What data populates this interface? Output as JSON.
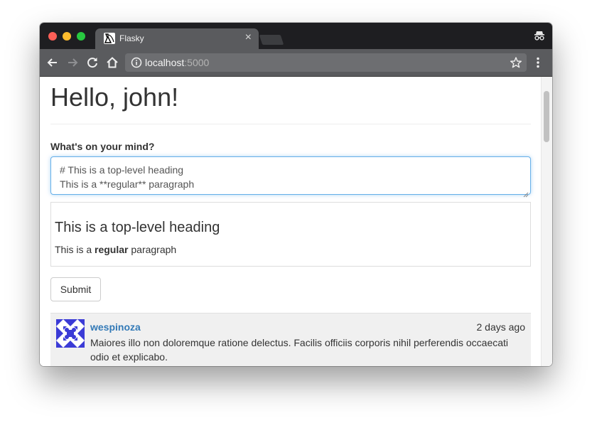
{
  "browser": {
    "tab_title": "Flasky",
    "tab_close": "×",
    "url_host": "localhost",
    "url_port": ":5000"
  },
  "page": {
    "greeting": "Hello, john!",
    "form": {
      "label": "What's on your mind?",
      "body_line1": "# This is a top-level heading",
      "body_line2": "This is a **regular** paragraph",
      "submit_label": "Submit"
    },
    "preview": {
      "heading": "This is a top-level heading",
      "para_before": "This is a ",
      "para_bold": "regular",
      "para_after": " paragraph"
    },
    "posts": [
      {
        "author": "wespinoza",
        "timestamp": "2 days ago",
        "body": "Maiores illo non doloremque ratione delectus. Facilis officiis corporis nihil perferendis occaecati odio et explicabo."
      }
    ]
  },
  "colors": {
    "link": "#337ab7",
    "focus": "#66afe9",
    "avatar": "#3b3bd6"
  }
}
